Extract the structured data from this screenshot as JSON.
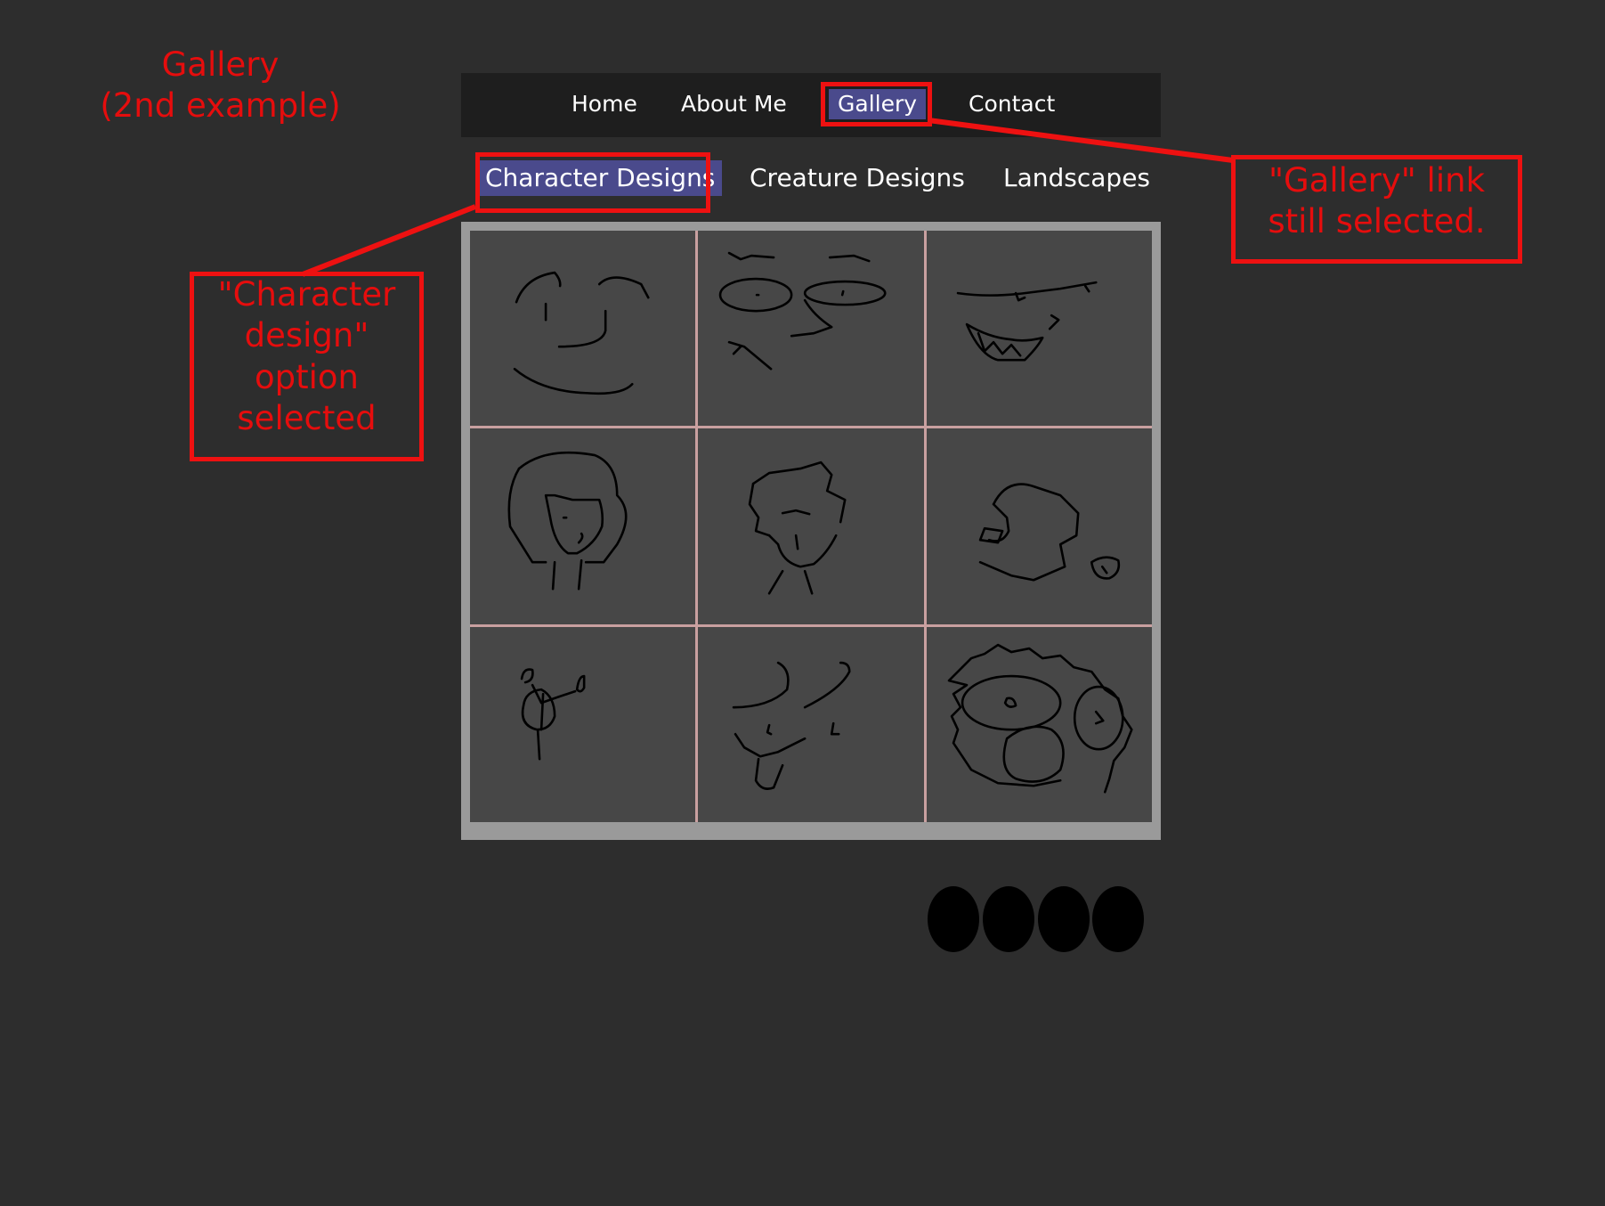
{
  "annotations": {
    "page_label": [
      "Gallery",
      "(2nd example)"
    ],
    "gallery_callout": [
      "\"Gallery\" link",
      "still selected."
    ],
    "character_callout": [
      "\"Character",
      "design\"",
      "option",
      "selected"
    ]
  },
  "nav": {
    "items": [
      {
        "label": "Home",
        "active": false
      },
      {
        "label": "About Me",
        "active": false
      },
      {
        "label": "Gallery",
        "active": true
      },
      {
        "label": "Contact",
        "active": false
      }
    ]
  },
  "subnav": {
    "items": [
      {
        "label": "Character Designs",
        "active": true
      },
      {
        "label": "Creature Designs",
        "active": false
      },
      {
        "label": "Landscapes",
        "active": false
      }
    ]
  },
  "gallery": {
    "thumbnail_count": 9
  },
  "pagination": {
    "dot_count": 4
  },
  "colors": {
    "background": "#2d2d2d",
    "nav_background": "#1e1e1e",
    "active_highlight": "#4a4a8c",
    "annotation_red": "#e60d0d"
  }
}
